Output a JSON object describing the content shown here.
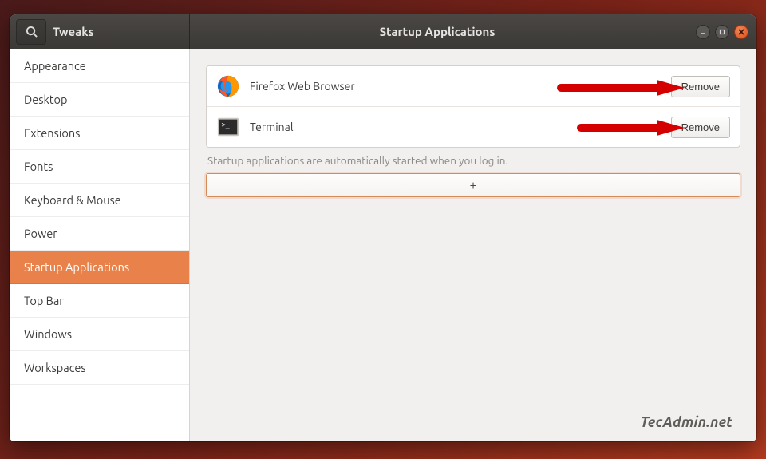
{
  "header": {
    "app_name": "Tweaks",
    "page_title": "Startup Applications"
  },
  "sidebar": {
    "items": [
      {
        "label": "Appearance",
        "active": false
      },
      {
        "label": "Desktop",
        "active": false
      },
      {
        "label": "Extensions",
        "active": false
      },
      {
        "label": "Fonts",
        "active": false
      },
      {
        "label": "Keyboard & Mouse",
        "active": false
      },
      {
        "label": "Power",
        "active": false
      },
      {
        "label": "Startup Applications",
        "active": true
      },
      {
        "label": "Top Bar",
        "active": false
      },
      {
        "label": "Windows",
        "active": false
      },
      {
        "label": "Workspaces",
        "active": false
      }
    ]
  },
  "main": {
    "apps": [
      {
        "icon": "firefox-icon",
        "name": "Firefox Web Browser",
        "remove_label": "Remove"
      },
      {
        "icon": "terminal-icon",
        "name": "Terminal",
        "remove_label": "Remove"
      }
    ],
    "hint": "Startup applications are automatically started when you log in.",
    "add_label": "+"
  },
  "colors": {
    "accent": "#e9824a",
    "arrow": "#d40000"
  },
  "watermark": "TecAdmin.net"
}
